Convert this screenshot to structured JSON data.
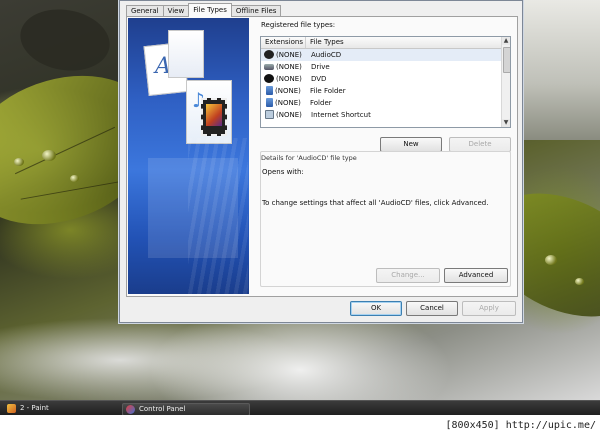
{
  "dialog": {
    "tabs": [
      {
        "label": "General"
      },
      {
        "label": "View"
      },
      {
        "label": "File Types",
        "active": true
      },
      {
        "label": "Offline Files"
      }
    ],
    "registered_label": "Registered file types:",
    "columns": [
      "Extensions",
      "File Types"
    ],
    "rows": [
      {
        "ext": "(NONE)",
        "type": "AudioCD",
        "icon": "cd-icon",
        "selected": true
      },
      {
        "ext": "(NONE)",
        "type": "Drive",
        "icon": "drive-icon"
      },
      {
        "ext": "(NONE)",
        "type": "DVD",
        "icon": "dvd-icon"
      },
      {
        "ext": "(NONE)",
        "type": "File Folder",
        "icon": "folder-icon"
      },
      {
        "ext": "(NONE)",
        "type": "Folder",
        "icon": "folder-icon"
      },
      {
        "ext": "(NONE)",
        "type": "Internet Shortcut",
        "icon": "shortcut-icon"
      }
    ],
    "new_label": "New",
    "delete_label": "Delete",
    "details_title": "Details for 'AudioCD' file type",
    "opens_with": "Opens with:",
    "advanced_text": "To change settings that affect all 'AudioCD' files, click Advanced.",
    "change_label": "Change...",
    "advanced_label": "Advanced",
    "ok_label": "OK",
    "cancel_label": "Cancel",
    "apply_label": "Apply"
  },
  "taskbar": {
    "items": [
      {
        "label": "2 - Paint",
        "icon": "paint-icon"
      },
      {
        "label": "Control Panel",
        "icon": "control-panel-icon"
      }
    ]
  },
  "credit": "[800x450] http://upic.me/"
}
